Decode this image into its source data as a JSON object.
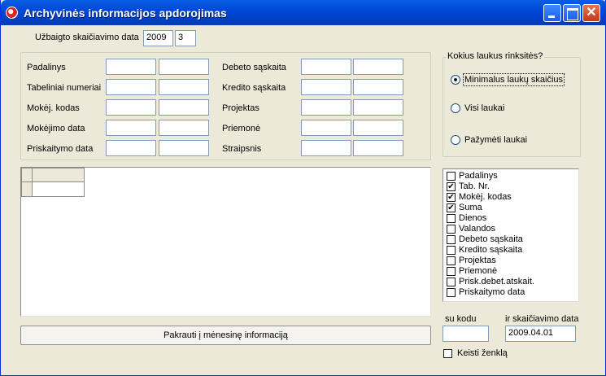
{
  "window": {
    "title": "Archyvinės informacijos apdorojimas"
  },
  "period": {
    "label": "Užbaigto skaičiavimo data",
    "year": "2009",
    "month": "3"
  },
  "filters": {
    "left": [
      "Padalinys",
      "Tabeliniai numeriai",
      "Mokėj. kodas",
      "Mokėjimo data",
      "Priskaitymo data"
    ],
    "right": [
      "Debeto sąskaita",
      "Kredito sąskaita",
      "Projektas",
      "Priemonė",
      "Straipsnis"
    ]
  },
  "fields_group": {
    "title": "Kokius laukus rinksitės?",
    "options": [
      "Minimalus laukų skaičius",
      "Visi laukai",
      "Pažymėti laukai"
    ]
  },
  "field_list": [
    {
      "label": "Padalinys",
      "checked": false
    },
    {
      "label": "Tab. Nr.",
      "checked": true
    },
    {
      "label": "Mokėj. kodas",
      "checked": true
    },
    {
      "label": "Suma",
      "checked": true
    },
    {
      "label": "Dienos",
      "checked": false
    },
    {
      "label": "Valandos",
      "checked": false
    },
    {
      "label": "Debeto sąskaita",
      "checked": false
    },
    {
      "label": "Kredito sąskaita",
      "checked": false
    },
    {
      "label": "Projektas",
      "checked": false
    },
    {
      "label": "Priemonė",
      "checked": false
    },
    {
      "label": "Prisk.debet.atskait.",
      "checked": false
    },
    {
      "label": "Priskaitymo data",
      "checked": false
    }
  ],
  "load_button": "Pakrauti į mėnesinę  informaciją",
  "su_kodu": {
    "label": "su kodu",
    "value": ""
  },
  "calc_date": {
    "label": "ir skaičiavimo data",
    "value": "2009.04.01"
  },
  "change_sign": {
    "label": "Keisti ženklą",
    "checked": false
  },
  "icons": {
    "minimize": "minimize-icon",
    "maximize": "maximize-icon",
    "close": "close-icon",
    "close_glyph": "✕",
    "check_glyph": "✔"
  }
}
